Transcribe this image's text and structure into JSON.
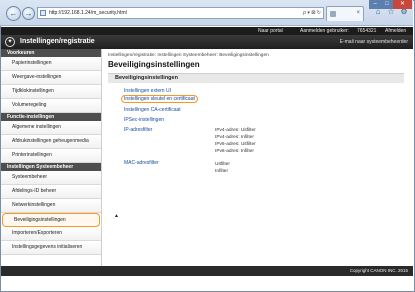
{
  "browser": {
    "url": "http://192.168.1.24/m_security.html",
    "tools": "ρ ▾ ⊠ ↻",
    "tab_close": "×"
  },
  "topbar": {
    "portal": "Naar portal",
    "user_label": "Aanmelden gebruiker:",
    "user_id": "7654321",
    "logout": "Afmelden"
  },
  "header": {
    "title": "Instellingen/registratie",
    "mail": "E-mail naar systeembeheerder"
  },
  "sidebar": {
    "groups": [
      {
        "heading": "Voorkeuren",
        "items": [
          "Papierinstellingen",
          "Weergave-instellingen",
          "Tijdklokinstellingen",
          "Volumeregeling"
        ]
      },
      {
        "heading": "Functie-instellingen",
        "items": [
          "Algemene instellingen",
          "Afdrukinstellingen geheugenmedia",
          "Printerinstellingen"
        ]
      },
      {
        "heading": "Instellingen Systeembeheer",
        "items": [
          "Systeembeheer",
          "Afdelings-ID beheer",
          "Netwerkinstellingen",
          "Beveiligingsinstellingen",
          "Importeren/Exporteren",
          "Instellingsgegevens initialiseren"
        ]
      }
    ],
    "active": "Beveiligingsinstellingen"
  },
  "main": {
    "breadcrumb": "Instellingen/registratie: Instellingen Systeembeheer: Beveiligingsinstellingen",
    "title": "Beveiligingsinstellingen",
    "section": "Beveiligingsinstellingen",
    "links": {
      "extern_ui": "Instellingen extern UI",
      "sleutel": "Instellingen sleutel en certificaat",
      "ca": "Instellingen CA-certificaat",
      "ipsec": "IPSec-instellingen",
      "ip_filter": "IP-adresfilter",
      "mac_filter": "MAC-adresfilter"
    },
    "ip_filter_values": [
      "IPv4-adres: Uitfilter",
      "IPv4-adres: Infilter",
      "IPv6-adres: Uitfilter",
      "IPv6-adres: Infilter"
    ],
    "mac_filter_values": [
      "Uitfilter",
      "Infilter"
    ],
    "up_arrow": "▲"
  },
  "footer": {
    "copyright": "Copyright CANON INC. 2015"
  },
  "colors": {
    "highlight": "#f09a2a",
    "link": "#1a4fa0",
    "header_bg": "#1f1f1f"
  }
}
